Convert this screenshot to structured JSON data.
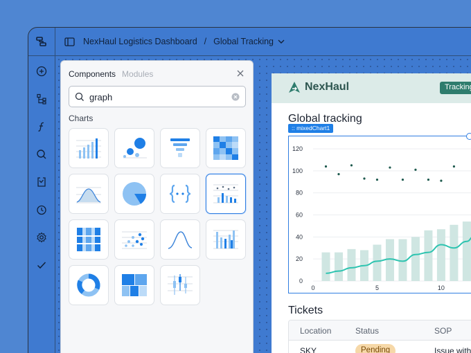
{
  "breadcrumb": {
    "app": "NexHaul Logistics Dashboard",
    "page": "Global Tracking"
  },
  "panel": {
    "tab_components": "Components",
    "tab_modules": "Modules",
    "search_value": "graph",
    "section_label": "Charts"
  },
  "card": {
    "brand": "NexHaul",
    "badge": "Tracking",
    "title": "Global tracking",
    "chart_chip": ":: mixedChart1",
    "tickets_title": "Tickets",
    "table": {
      "columns": [
        "Location",
        "Status",
        "SOP"
      ],
      "row": {
        "location": "SKY",
        "status": "Pending",
        "sop": "Issue with"
      }
    }
  },
  "colors": {
    "accent": "#2f7de1",
    "teal": "#2ec4b0",
    "bar": "#cfe6e2",
    "dot": "#1e5a4e"
  },
  "chart_data": {
    "type": "bar",
    "title": "",
    "xlabel": "",
    "ylabel": "",
    "ylim": [
      0,
      120
    ],
    "yticks": [
      0,
      20,
      40,
      60,
      80,
      100,
      120
    ],
    "xticks": [
      0,
      5,
      10
    ],
    "series": [
      {
        "type": "bar",
        "x": [
          1,
          2,
          3,
          4,
          5,
          6,
          7,
          8,
          9,
          10,
          11,
          12
        ],
        "values": [
          26,
          26,
          29,
          28,
          33,
          38,
          38,
          40,
          46,
          47,
          51,
          54
        ]
      },
      {
        "type": "line",
        "x": [
          1,
          2,
          3,
          4,
          5,
          6,
          7,
          8,
          9,
          10,
          11,
          12,
          12.6
        ],
        "values": [
          7,
          9,
          12,
          14,
          18,
          20,
          18,
          24,
          26,
          33,
          30,
          36,
          41
        ]
      },
      {
        "type": "scatter",
        "x": [
          1,
          2,
          3,
          4,
          5,
          6,
          7,
          8,
          9,
          10,
          11
        ],
        "values": [
          104,
          97,
          105,
          93,
          92,
          103,
          92,
          101,
          92,
          91,
          104
        ]
      }
    ]
  }
}
